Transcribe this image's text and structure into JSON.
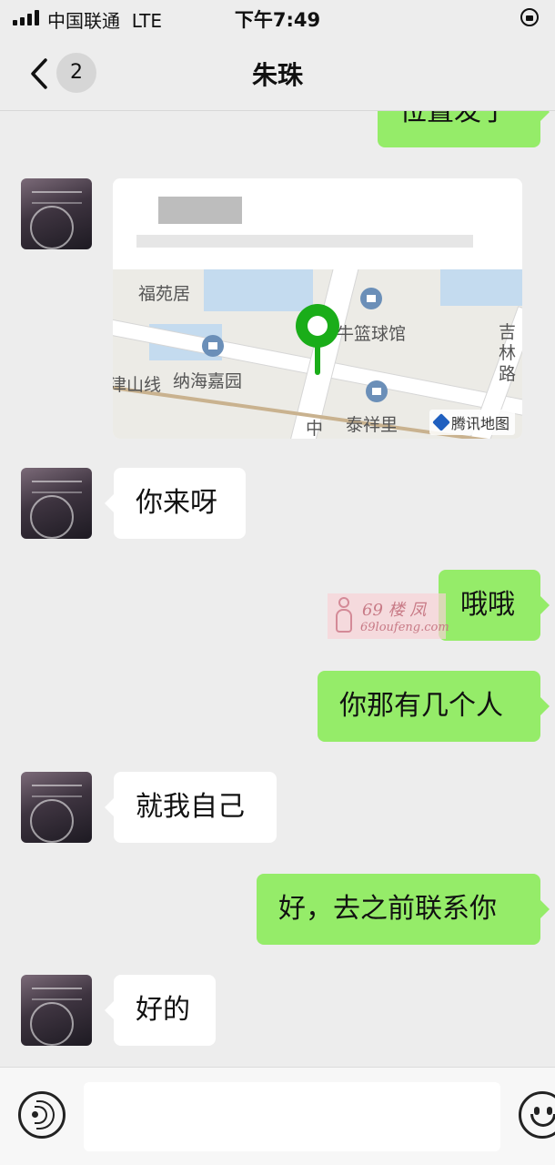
{
  "status_bar": {
    "carrier": "中国联通",
    "network": "LTE",
    "time": "下午7:49"
  },
  "nav": {
    "unread_count": "2",
    "title": "朱珠"
  },
  "messages": [
    {
      "sender": "me",
      "type": "text",
      "text": "位置发了"
    },
    {
      "sender": "contact",
      "type": "location",
      "map": {
        "labels": [
          "福苑居",
          "牛篮球馆",
          "纳海嘉园",
          "泰祥里",
          "津山线",
          "吉林路",
          "中"
        ],
        "provider": "腾讯地图"
      }
    },
    {
      "sender": "contact",
      "type": "text",
      "text": "你来呀"
    },
    {
      "sender": "me",
      "type": "text",
      "text": "哦哦"
    },
    {
      "sender": "me",
      "type": "text",
      "text": "你那有几个人"
    },
    {
      "sender": "contact",
      "type": "text",
      "text": "就我自己"
    },
    {
      "sender": "me",
      "type": "text",
      "text": "好，去之前联系你"
    },
    {
      "sender": "contact",
      "type": "text",
      "text": "好的"
    }
  ],
  "watermark": {
    "line1": "69 楼 凤",
    "line2": "69loufeng.com"
  },
  "input_bar": {
    "placeholder": ""
  },
  "icons": [
    "chevron-left-icon",
    "voice-icon",
    "emoji-icon",
    "map-pin-icon",
    "lock-rotation-icon",
    "signal-icon"
  ],
  "colors": {
    "outgoing_bubble": "#95ec69",
    "incoming_bubble": "#ffffff",
    "background": "#ededed",
    "map_pin": "#1aad19"
  }
}
